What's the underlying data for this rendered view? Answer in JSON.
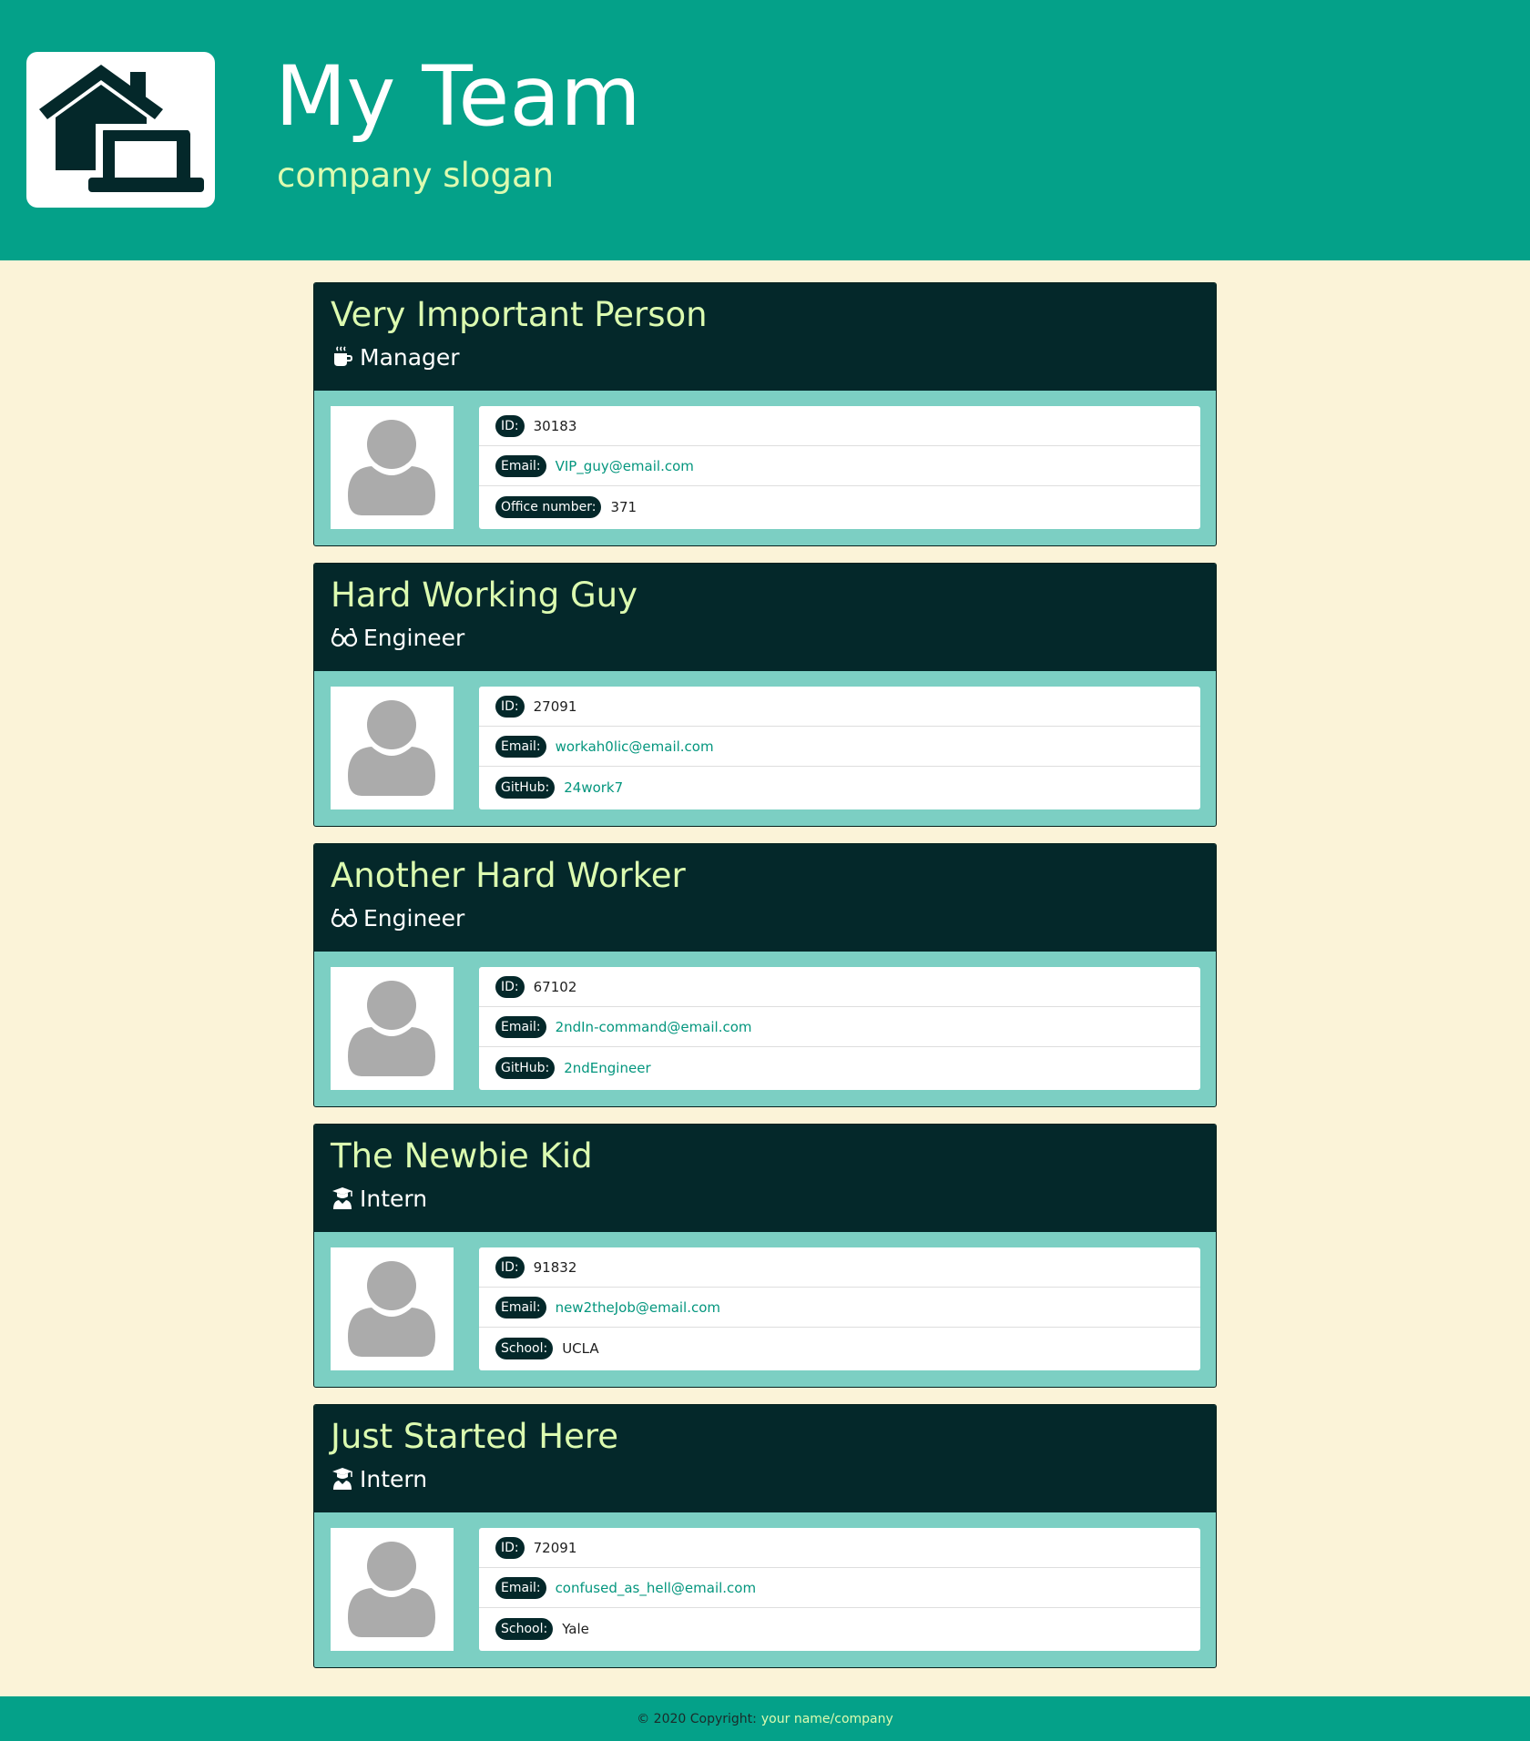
{
  "header": {
    "title": "My Team",
    "slogan": "company slogan",
    "logo_icon": "house-laptop-icon"
  },
  "members": [
    {
      "name": "Very Important Person",
      "role": "Manager",
      "role_icon": "mug-icon",
      "id_label": "ID:",
      "id": "30183",
      "email_label": "Email:",
      "email": "VIP_guy@email.com",
      "extra_label": "Office number:",
      "extra_value": "371",
      "extra_is_link": false
    },
    {
      "name": "Hard Working Guy",
      "role": "Engineer",
      "role_icon": "glasses-icon",
      "id_label": "ID:",
      "id": "27091",
      "email_label": "Email:",
      "email": "workah0lic@email.com",
      "extra_label": "GitHub:",
      "extra_value": "24work7",
      "extra_is_link": true
    },
    {
      "name": "Another Hard Worker",
      "role": "Engineer",
      "role_icon": "glasses-icon",
      "id_label": "ID:",
      "id": "67102",
      "email_label": "Email:",
      "email": "2ndIn-command@email.com",
      "extra_label": "GitHub:",
      "extra_value": "2ndEngineer",
      "extra_is_link": true
    },
    {
      "name": "The Newbie Kid",
      "role": "Intern",
      "role_icon": "graduate-icon",
      "id_label": "ID:",
      "id": "91832",
      "email_label": "Email:",
      "email": "new2theJob@email.com",
      "extra_label": "School:",
      "extra_value": "UCLA",
      "extra_is_link": false
    },
    {
      "name": "Just Started Here",
      "role": "Intern",
      "role_icon": "graduate-icon",
      "id_label": "ID:",
      "id": "72091",
      "email_label": "Email:",
      "email": "confused_as_hell@email.com",
      "extra_label": "School:",
      "extra_value": "Yale",
      "extra_is_link": false
    }
  ],
  "footer": {
    "copyright": "© 2020 Copyright:",
    "brand": "your name/company"
  },
  "colors": {
    "header_bg": "#04a189",
    "page_bg": "#fbf3d8",
    "card_header_bg": "#04282a",
    "card_body_bg": "#7ccfc3",
    "accent_text": "#dcfbb0",
    "link": "#04967e"
  }
}
